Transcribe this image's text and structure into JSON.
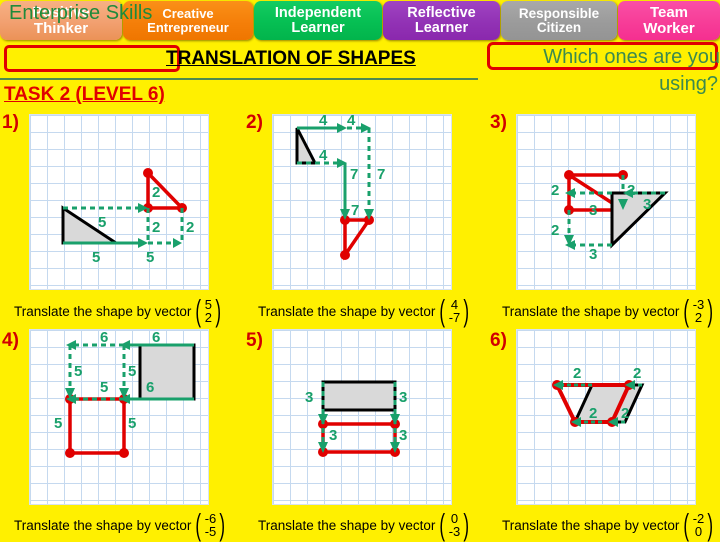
{
  "header": {
    "tabs": [
      {
        "line1": "Positive",
        "line2": "Thinker",
        "color": "#f2a070",
        "name": "positive-thinker"
      },
      {
        "line1": "Creative",
        "line2": "Entrepreneur",
        "color": "#f57f09",
        "name": "creative-entrepreneur"
      },
      {
        "line1": "Independent",
        "line2": "Learner",
        "color": "#06bf53",
        "name": "independent-learner"
      },
      {
        "line1": "Reflective",
        "line2": "Learner",
        "color": "#9232b5",
        "name": "reflective-learner"
      },
      {
        "line1": "Responsible",
        "line2": "Citizen",
        "color": "#9b9b9b",
        "name": "responsible-citizen"
      },
      {
        "line1": "Team",
        "line2": "Worker",
        "color": "#f73d98",
        "name": "team-worker"
      }
    ]
  },
  "title": {
    "enterprise_skills": "Enterprise Skills",
    "main": "TRANSLATION OF SHAPES",
    "which_line1": "Which ones are you",
    "which_line2": "using?",
    "task": "TASK 2 (LEVEL 6)",
    "accent_red": "#E00000",
    "accent_green": "#3C8A4E",
    "background": "#FFF000"
  },
  "questions": [
    {
      "number": "1)",
      "caption": "Translate the shape by vector",
      "vector_x": "5",
      "vector_y": "2",
      "labels": [
        "5",
        "5",
        "2",
        "2",
        "5",
        "2"
      ]
    },
    {
      "number": "2)",
      "caption": "Translate the shape by vector",
      "vector_x": "4",
      "vector_y": "-7",
      "labels": [
        "4",
        "4",
        "4",
        "7",
        "7",
        "7"
      ]
    },
    {
      "number": "3)",
      "caption": "Translate the shape by vector",
      "vector_x": "-3",
      "vector_y": "2",
      "labels": [
        "2",
        "2",
        "2",
        "3",
        "3",
        "3"
      ]
    },
    {
      "number": "4)",
      "caption": "Translate the shape by vector",
      "vector_x": "-6",
      "vector_y": "-5",
      "labels": [
        "6",
        "6",
        "6",
        "5",
        "5",
        "5"
      ]
    },
    {
      "number": "5)",
      "caption": "Translate the shape by vector",
      "vector_x": "0",
      "vector_y": "-3",
      "labels": [
        "3",
        "3",
        "3"
      ]
    },
    {
      "number": "6)",
      "caption": "Translate the shape by vector",
      "vector_x": "-2",
      "vector_y": "0",
      "labels": [
        "2",
        "2",
        "2",
        "2"
      ]
    }
  ],
  "colors": {
    "shape_original_stroke": "#000000",
    "shape_original_fill": "#d9d9d9",
    "shape_image_stroke": "#E00000",
    "arrow_green": "#19A06B"
  }
}
